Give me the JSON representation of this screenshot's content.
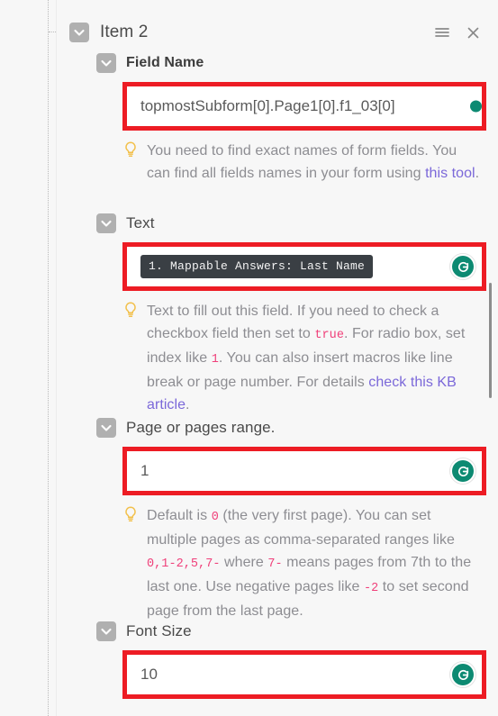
{
  "header": {
    "title": "Item 2",
    "toggle_icon": "chevron-down-icon",
    "menu_icon": "hamburger-menu-icon",
    "close_icon": "close-icon"
  },
  "sections": [
    {
      "id": "field-name",
      "label": "Field Name",
      "toggle_icon": "chevron-down-icon",
      "value": "topmostSubform[0].Page1[0].f1_03[0]",
      "placeholder": "",
      "refresh_icon": "refresh-icon",
      "hint": {
        "icon": "lightbulb-icon",
        "parts": [
          {
            "t": "You need to find exact names of form fields. You can find all fields names in your form using ",
            "k": "text"
          },
          {
            "t": "this tool",
            "k": "link"
          },
          {
            "t": ".",
            "k": "text"
          }
        ]
      }
    },
    {
      "id": "text",
      "label": "Text",
      "toggle_icon": "chevron-down-icon",
      "chip": "1. Mappable Answers: Last Name",
      "refresh_icon": "refresh-icon",
      "hint": {
        "icon": "lightbulb-icon",
        "parts": [
          {
            "t": "Text to fill out this field. If you need to check a checkbox field then set to ",
            "k": "text"
          },
          {
            "t": "true",
            "k": "token"
          },
          {
            "t": ". For radio box, set index like ",
            "k": "text"
          },
          {
            "t": "1",
            "k": "token"
          },
          {
            "t": ". You can also insert macros like line break or page number. For details ",
            "k": "text"
          },
          {
            "t": "check this KB article",
            "k": "link"
          },
          {
            "t": ".",
            "k": "text"
          }
        ]
      }
    },
    {
      "id": "page-range",
      "label": "Page or pages range.",
      "toggle_icon": "chevron-down-icon",
      "value": "1",
      "refresh_icon": "refresh-icon",
      "hint": {
        "icon": "lightbulb-icon",
        "parts": [
          {
            "t": "Default is ",
            "k": "text"
          },
          {
            "t": "0",
            "k": "token"
          },
          {
            "t": " (the very first page). You can set multiple pages as comma-separated ranges like ",
            "k": "text"
          },
          {
            "t": "0,1-2,5,7-",
            "k": "token"
          },
          {
            "t": " where ",
            "k": "text"
          },
          {
            "t": "7-",
            "k": "token"
          },
          {
            "t": " means pages from 7th to the last one. Use negative pages like ",
            "k": "text"
          },
          {
            "t": "-2",
            "k": "token"
          },
          {
            "t": " to set second page from the last page.",
            "k": "text"
          }
        ]
      }
    },
    {
      "id": "font-size",
      "label": "Font Size",
      "toggle_icon": "chevron-down-icon",
      "value": "10",
      "refresh_icon": "refresh-icon",
      "hint": null
    }
  ],
  "colors": {
    "highlight_red": "#ed1c24",
    "accent_teal": "#0d8a72",
    "link_purple": "#7b68d9",
    "token_pink": "#f0407a",
    "chip_bg": "#3a3f44",
    "toggle_grey": "#b0b0b0",
    "page_bg": "#f7f7f7"
  },
  "scrollbar": {
    "name": "vertical-scrollbar",
    "visible": true
  }
}
